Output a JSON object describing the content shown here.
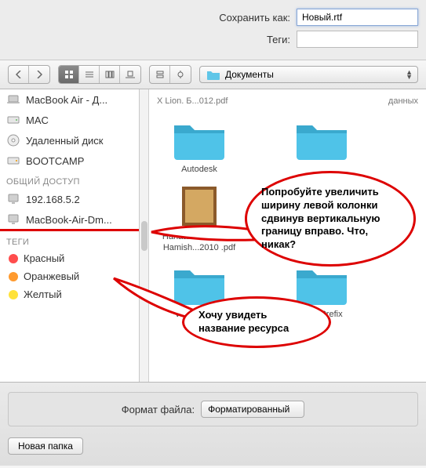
{
  "save": {
    "save_as_label": "Сохранить как:",
    "filename": "Новый.rtf",
    "tags_label": "Теги:"
  },
  "toolbar": {
    "location": "Документы"
  },
  "sidebar": {
    "devices": [
      {
        "label": "MacBook Air - Д..."
      },
      {
        "label": "MAC"
      },
      {
        "label": "Удаленный диск"
      },
      {
        "label": "BOOTCAMP"
      }
    ],
    "shared_header": "ОБЩИЙ ДОСТУП",
    "shared": [
      {
        "label": "192.168.5.2"
      },
      {
        "label": "MacBook-Air-Dm..."
      }
    ],
    "tags_header": "ТЕГИ",
    "tags": [
      {
        "label": "Красный",
        "color": "#ff4d4d"
      },
      {
        "label": "Оранжевый",
        "color": "#ff9a2e"
      },
      {
        "label": "Желтый",
        "color": "#ffe23a"
      }
    ]
  },
  "content": {
    "crumb_left": "X Lion. Б...012.pdf",
    "crumb_right": "данных",
    "items": [
      {
        "label": "Autodesk",
        "type": "folder"
      },
      {
        "label": "",
        "type": "folder"
      },
      {
        "label": "Hanaan Rosenthal,\nHamish...2010 .pdf",
        "type": "book"
      },
      {
        "label": "",
        "type": "folder"
      },
      {
        "label": "Virtual Des...",
        "type": "folder"
      },
      {
        "label": "WinePrefix",
        "type": "folder"
      }
    ]
  },
  "bottom": {
    "format_label": "Формат файла:",
    "format_value": "Форматированный",
    "new_folder": "Новая папка"
  },
  "callouts": {
    "c1": "Попробуйте увеличить ширину левой колонки сдвинув вертикальную границу вправо. Что, никак?",
    "c2": "Хочу увидеть название ресурса"
  }
}
